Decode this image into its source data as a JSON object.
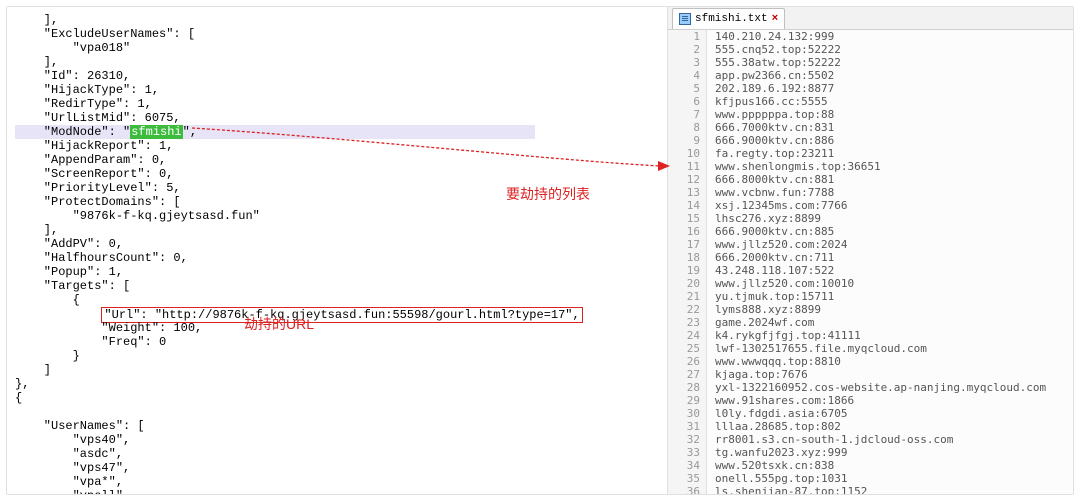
{
  "annotations": {
    "hijack_list": "要劫持的列表",
    "hijack_url": "劫持的URL"
  },
  "tab": {
    "filename": "sfmishi.txt",
    "close": "×"
  },
  "json_lines": [
    "    ],",
    "    \"ExcludeUserNames\": [",
    "        \"vpa018\"",
    "    ],",
    "    \"Id\": 26310,",
    "    \"HijackType\": 1,",
    "    \"RedirType\": 1,",
    "    \"UrlListMid\": 6075,",
    "__HL__    \"ModNode\": \"__GREEN__sfmishi__/GREEN__\",",
    "    \"HijackReport\": 1,",
    "    \"AppendParam\": 0,",
    "    \"ScreenReport\": 0,",
    "    \"PriorityLevel\": 5,",
    "    \"ProtectDomains\": [",
    "        \"9876k-f-kq.gjeytsasd.fun\"",
    "    ],",
    "    \"AddPV\": 0,",
    "    \"HalfhoursCount\": 0,",
    "    \"Popup\": 1,",
    "    \"Targets\": [",
    "        {",
    "__BOX__            \"Url\": \"http://9876k-f-kq.gjeytsasd.fun:55598/gourl.html?type=17\",__/BOX__",
    "            \"Weight\": 100,",
    "            \"Freq\": 0",
    "        }",
    "    ]",
    "},",
    "{",
    "    ",
    "    \"UserNames\": [",
    "        \"vps40\",",
    "        \"asdc\",",
    "        \"vps47\",",
    "        \"vpa*\",",
    "        \"vpsll\","
  ],
  "file_lines": [
    "140.210.24.132:999",
    "555.cnq52.top:52222",
    "555.38atw.top:52222",
    "app.pw2366.cn:5502",
    "202.189.6.192:8877",
    "kfjpus166.cc:5555",
    "www.ppppppa.top:88",
    "666.7000ktv.cn:831",
    "666.9000ktv.cn:886",
    "fa.regty.top:23211",
    "www.shenlongmis.top:36651",
    "666.8000ktv.cn:881",
    "www.vcbnw.fun:7788",
    "xsj.12345ms.com:7766",
    "lhsc276.xyz:8899",
    "666.9000ktv.cn:885",
    "www.jllz520.com:2024",
    "666.2000ktv.cn:711",
    "43.248.118.107:522",
    "www.jllz520.com:10010",
    "yu.tjmuk.top:15711",
    "lyms888.xyz:8899",
    "game.2024wf.com",
    "k4.rykgfjfgj.top:41111",
    "lwf-1302517655.file.myqcloud.com",
    "www.wwwqqq.top:8810",
    "kjaga.top:7676",
    "yxl-1322160952.cos-website.ap-nanjing.myqcloud.com",
    "www.91shares.com:1866",
    "l0ly.fdgdi.asia:6705",
    "lllaa.28685.top:802",
    "rr8001.s3.cn-south-1.jdcloud-oss.com",
    "tg.wanfu2023.xyz:999",
    "www.520tsxk.cn:838",
    "onell.555pg.top:1031",
    "ls.shenjian-87.top:1152"
  ]
}
